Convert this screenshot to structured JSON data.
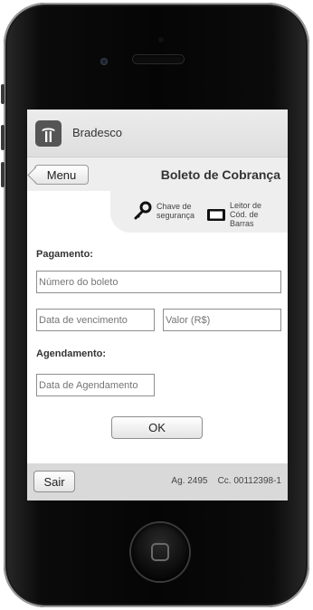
{
  "app": {
    "title": "Bradesco"
  },
  "nav": {
    "menu_label": "Menu",
    "page_title": "Boleto de Cobrança"
  },
  "tools": {
    "security_key": {
      "label": "Chave de segurança",
      "icon": "key-icon"
    },
    "barcode_reader": {
      "label": "Leitor de Cód. de Barras",
      "icon": "barcode-reader-icon"
    }
  },
  "form": {
    "payment_label": "Pagamento:",
    "boleto_number_placeholder": "Número do boleto",
    "due_date_placeholder": "Data de vencimento",
    "value_placeholder": "Valor (R$)",
    "scheduling_label": "Agendamento:",
    "schedule_date_placeholder": "Data de Agendamento",
    "ok_label": "OK"
  },
  "footer": {
    "exit_label": "Sair",
    "agency": "Ag. 2495",
    "account": "Cc. 00112398-1"
  },
  "colors": {
    "bar_bg": "#eeeeee",
    "footer_bg": "#d9d9d9",
    "logo_bg": "#555555"
  }
}
